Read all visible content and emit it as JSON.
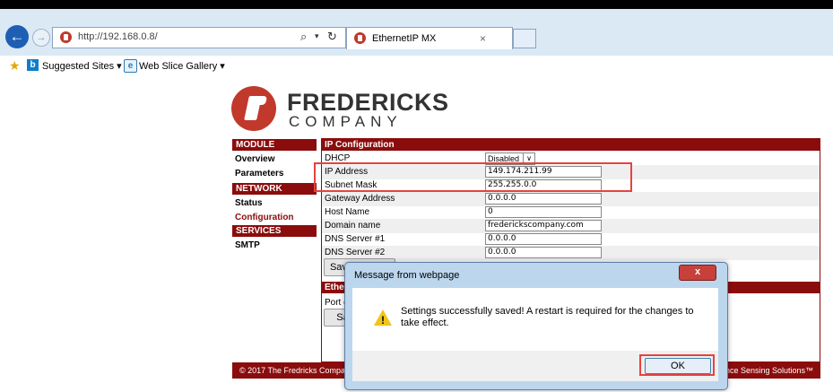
{
  "browser": {
    "url": "http://192.168.0.8/",
    "tab_title": "EthernetIP MX",
    "tab_close": "×",
    "search_icon_glyph": "⌕",
    "refresh_icon_glyph": "↻",
    "favorites": {
      "suggested_sites": "Suggested Sites ▾",
      "web_slice_gallery": "Web Slice Gallery ▾"
    }
  },
  "logo": {
    "line1": "FREDERICKS",
    "line2": "COMPANY"
  },
  "nav": {
    "sections": [
      {
        "heading": "MODULE",
        "items": [
          "Overview",
          "Parameters"
        ]
      },
      {
        "heading": "NETWORK",
        "items": [
          "Status",
          "Configuration"
        ]
      },
      {
        "heading": "SERVICES",
        "items": [
          "SMTP"
        ]
      }
    ],
    "active_item": "Configuration"
  },
  "ip_config": {
    "heading": "IP Configuration",
    "dhcp_label": "DHCP",
    "dhcp_value": "Disabled",
    "fields": [
      {
        "label": "IP Address",
        "value": "149.174.211.99"
      },
      {
        "label": "Subnet Mask",
        "value": "255.255.0.0"
      },
      {
        "label": "Gateway Address",
        "value": "0.0.0.0"
      },
      {
        "label": "Host Name",
        "value": "0"
      },
      {
        "label": "Domain name",
        "value": "frederickscompany.com"
      },
      {
        "label": "DNS Server #1",
        "value": "0.0.0.0"
      },
      {
        "label": "DNS Server #2",
        "value": "0.0.0.0"
      }
    ],
    "save_label": "Save settings"
  },
  "ethernet_section": {
    "heading": "Ether",
    "port_label": "Port c",
    "save_label": "Sa"
  },
  "footer": {
    "left": "© 2017 The Fredricks Company",
    "right": "mance Sensing Solutions™"
  },
  "dialog": {
    "title": "Message from webpage",
    "close_label": "x",
    "message": "Settings successfully saved! A restart is required for the changes to take effect.",
    "ok_label": "OK"
  },
  "colors": {
    "brand_red": "#8b0c0c",
    "highlight_red": "#e7423f",
    "chrome_blue": "#dbe9f5"
  }
}
